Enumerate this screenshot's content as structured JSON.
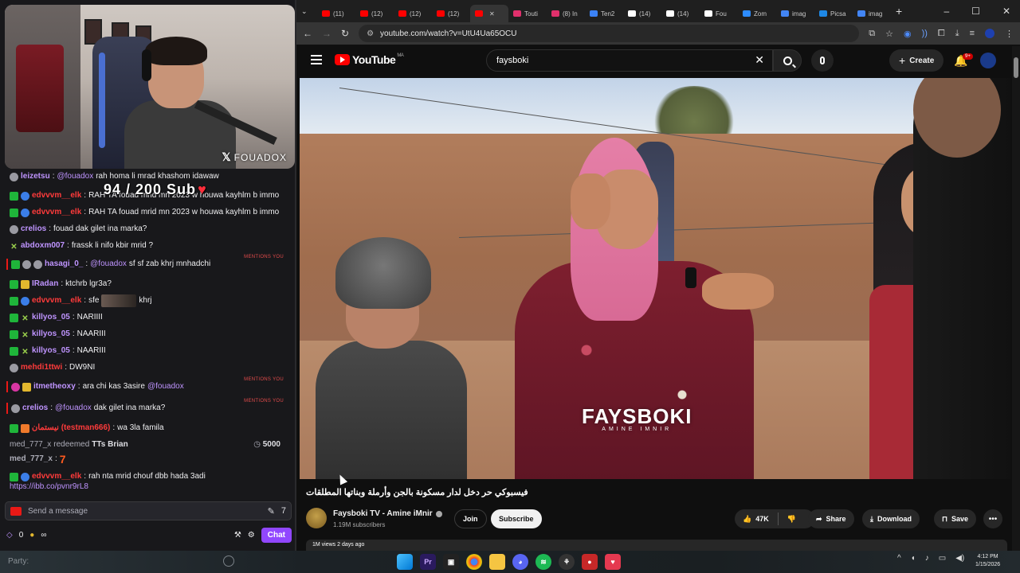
{
  "stream": {
    "webcam_brand": "FOUADOX",
    "sub_goal": "94 / 200 Sub",
    "chat": [
      {
        "user": "leizetsu",
        "color": "#bf94ff",
        "mention": "@fouadox",
        "text": "rah homa li mrad khashom idawaw",
        "badges": [
          "gray"
        ]
      },
      {
        "user": "edvvvm__elk",
        "color": "#ff3b3b",
        "text": "RAH TA fouad mrid mn 2023 w houwa kayhlm b immo",
        "badges": [
          "green",
          "blue"
        ]
      },
      {
        "user": "edvvvm__elk",
        "color": "#ff3b3b",
        "text": "RAH TA fouad mrid mn 2023 w houwa kayhlm b immo",
        "badges": [
          "green",
          "blue"
        ]
      },
      {
        "user": "crelios",
        "color": "#bf94ff",
        "text": "fouad dak gilet ina marka?",
        "badges": [
          "gray"
        ]
      },
      {
        "user": "abdoxm007",
        "color": "#bf94ff",
        "text": "frassk li nifo kbir mrid ?",
        "badges": [
          "x"
        ]
      },
      {
        "user": "hasagi_0_",
        "color": "#bf94ff",
        "mention": "@fouadox",
        "text": "sf sf zab khrj mnhadchi",
        "badges": [
          "green",
          "gray",
          "gray"
        ],
        "is_mention": true
      },
      {
        "user": "IRadan",
        "color": "#bf94ff",
        "text": "ktchrb lgr3a?",
        "badges": [
          "green",
          "gold"
        ]
      },
      {
        "user": "edvvvm__elk",
        "color": "#ff3b3b",
        "text": "sfe",
        "after_emote": "khrj",
        "badges": [
          "green",
          "blue"
        ]
      },
      {
        "user": "killyos_05",
        "color": "#bf94ff",
        "text": "NARIIII",
        "badges": [
          "green",
          "x"
        ]
      },
      {
        "user": "killyos_05",
        "color": "#bf94ff",
        "text": "NAARIII",
        "badges": [
          "green",
          "x"
        ]
      },
      {
        "user": "killyos_05",
        "color": "#bf94ff",
        "text": "NAARIII",
        "badges": [
          "green",
          "x"
        ]
      },
      {
        "user": "mehdi1ttwi",
        "color": "#ff3b3b",
        "text": "DW9NI",
        "badges": [
          "gray"
        ]
      },
      {
        "user": "itmetheoxy",
        "color": "#bf94ff",
        "text": "ara chi kas 3asire",
        "mention_after": "@fouadox",
        "badges": [
          "pink",
          "gold"
        ],
        "is_mention": true
      },
      {
        "user": "crelios",
        "color": "#bf94ff",
        "mention": "@fouadox",
        "text": "dak gilet ina marka?",
        "badges": [
          "gray"
        ],
        "is_mention": true
      },
      {
        "user": "نيستمان (testman666)",
        "color": "#ff3b3b",
        "text": "wa 3la famila",
        "badges": [
          "green",
          "orange"
        ]
      }
    ],
    "mentions_label": "MENTIONS YOU",
    "redeem": {
      "user": "med_777_x",
      "action": "redeemed",
      "reward": "TTs Brian",
      "points": "5000"
    },
    "redeem_msg": {
      "user": "med_777_x",
      "text": "7"
    },
    "last_msg": {
      "user": "edvvvm__elk",
      "color": "#ff3b3b",
      "text": "rah nta mrid chouf dbb hada 3adi",
      "link": "https://ibb.co/pvnr9rL8"
    },
    "input_placeholder": "Send a message",
    "footer_points": "0",
    "footer_inf": "∞",
    "chat_button": "Chat"
  },
  "browser": {
    "tabs": [
      {
        "label": "(11)",
        "color": "#ff0000"
      },
      {
        "label": "(12)",
        "color": "#ff0000"
      },
      {
        "label": "(12)",
        "color": "#ff0000"
      },
      {
        "label": "(12)",
        "color": "#ff0000"
      },
      {
        "label": "",
        "color": "#ff0000",
        "active": true
      },
      {
        "label": "Touti",
        "color": "#e1306c"
      },
      {
        "label": "(8) In",
        "color": "#e1306c"
      },
      {
        "label": "Ten2",
        "color": "#3b82f6"
      },
      {
        "label": "(14)",
        "color": "#ffffff"
      },
      {
        "label": "(14)",
        "color": "#ffffff"
      },
      {
        "label": "Fou",
        "color": "#ffffff"
      },
      {
        "label": "Zom",
        "color": "#2d8cff"
      },
      {
        "label": "imag",
        "color": "#4285f4"
      },
      {
        "label": "Picsa",
        "color": "#1e88e5"
      },
      {
        "label": "imag",
        "color": "#4285f4"
      }
    ],
    "new_tab": "+",
    "url": "youtube.com/watch?v=UtU4Ua65OCU"
  },
  "youtube": {
    "logo": "YouTube",
    "region": "MA",
    "search_value": "faysboki",
    "create_label": "Create",
    "bell_badge": "9+",
    "video_watermark": "FAYSBOKI",
    "video_watermark_sub": "AMINE IMNIR",
    "title": "فيسبوكي حر دخل لدار مسكونة بالجن وأرملة وبناتها المطلقات",
    "channel": "Faysboki TV - Amine iMnir",
    "subscribers": "1.19M subscribers",
    "join": "Join",
    "subscribe": "Subscribe",
    "likes": "47K",
    "share": "Share",
    "download": "Download",
    "save": "Save",
    "desc_peek": "1M views  2 days ago"
  },
  "taskbar": {
    "party": "Party:",
    "time": "4:12 PM",
    "date": "1/15/2026"
  }
}
